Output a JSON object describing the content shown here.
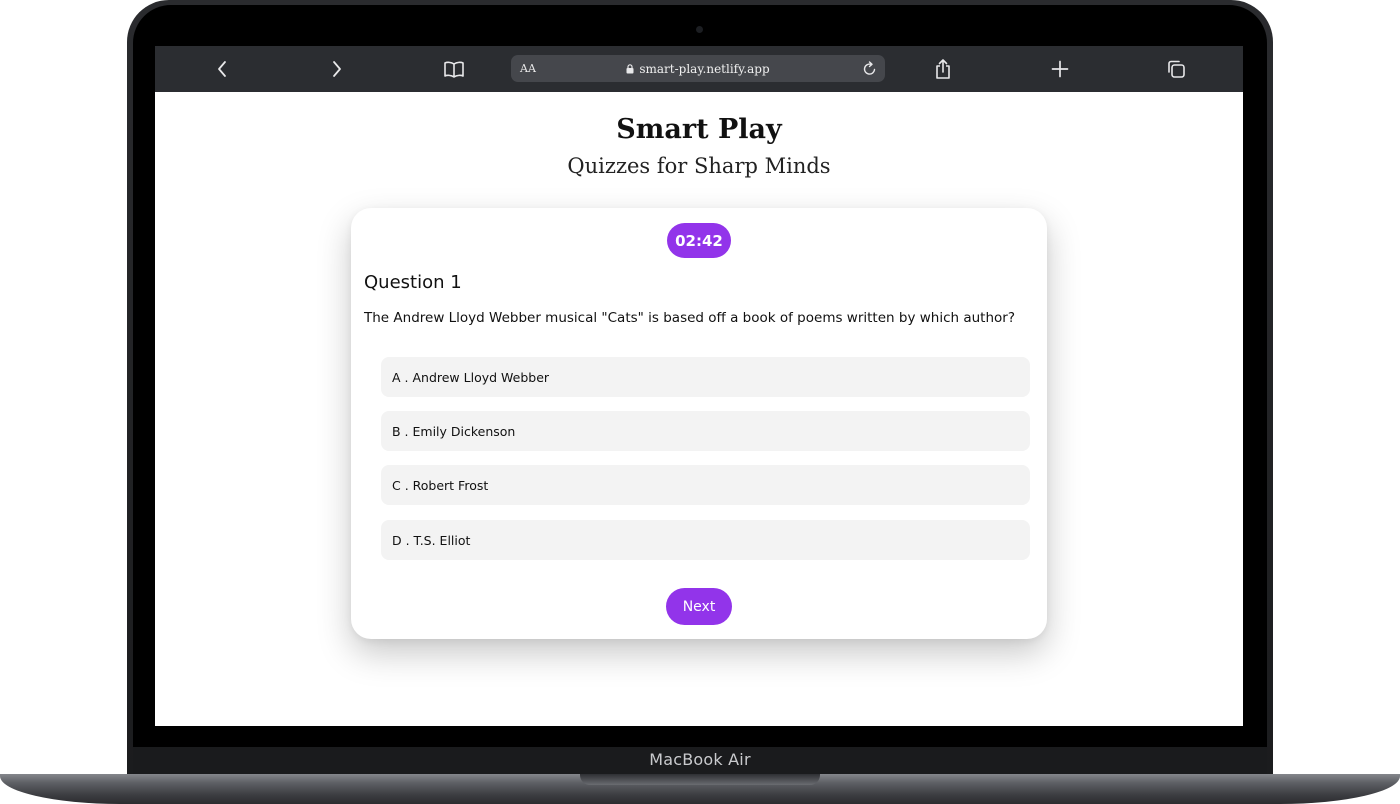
{
  "device": {
    "label": "MacBook Air"
  },
  "browser": {
    "address_bar": {
      "text_size_label": "AA",
      "url": "smart-play.netlify.app"
    },
    "icons": [
      "back-icon",
      "forward-icon",
      "reader-icon",
      "lock-icon",
      "reload-icon",
      "share-icon",
      "new-tab-icon",
      "tabs-icon"
    ]
  },
  "page": {
    "title": "Smart Play",
    "subtitle": "Quizzes for Sharp Minds",
    "quiz": {
      "timer": "02:42",
      "question_label": "Question 1",
      "question_text": "The Andrew Lloyd Webber musical \"Cats\" is based off a book of poems written by which author?",
      "options": [
        "A . Andrew Lloyd Webber",
        "B . Emily Dickenson",
        "C . Robert Frost",
        "D . T.S. Elliot"
      ],
      "next_label": "Next"
    }
  },
  "colors": {
    "accent": "#9234ea",
    "option_bg": "#f3f3f3",
    "toolbar_bg": "#2b2d31"
  }
}
